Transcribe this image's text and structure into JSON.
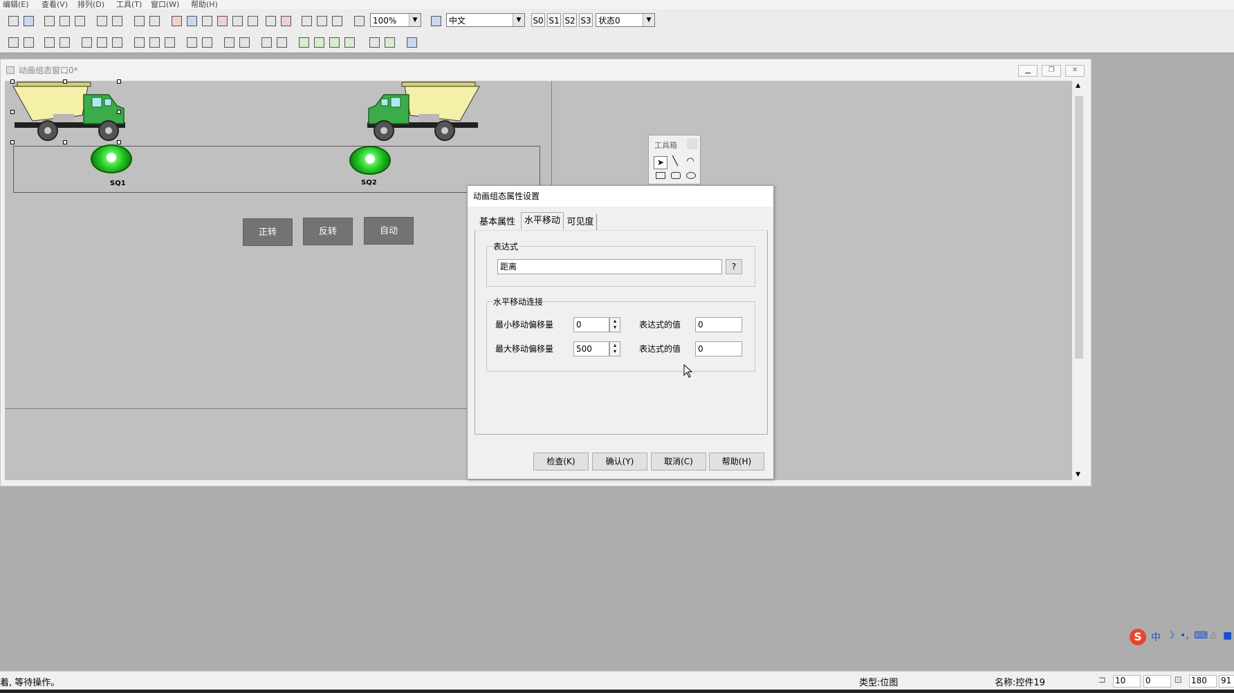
{
  "menu": [
    "编辑(E)",
    "查看(V)",
    "排列(D)",
    "工具(T)",
    "窗口(W)",
    "帮助(H)"
  ],
  "toolbar": {
    "zoom": "100%",
    "language": "中文",
    "states": [
      "S0",
      "S1",
      "S2",
      "S3"
    ],
    "state_select": "状态0"
  },
  "child_window": {
    "title": "动画组态窗口0*",
    "buttons": [
      "minimize-icon",
      "restore-icon",
      "close-icon"
    ]
  },
  "scene": {
    "sensors": [
      {
        "label": "SQ1",
        "color": "#22cc22"
      },
      {
        "label": "SQ2",
        "color": "#22cc22"
      }
    ],
    "trucks": [
      "truck-left",
      "truck-right"
    ],
    "buttons": [
      "正转",
      "反转",
      "自动"
    ]
  },
  "toolbox": {
    "title": "工具箱",
    "tools": [
      "pointer-icon",
      "line-icon",
      "arc-icon",
      "rectangle-icon",
      "rounded-rect-icon",
      "ellipse-icon"
    ]
  },
  "dialog": {
    "title": "动画组态属性设置",
    "tabs": [
      "基本属性",
      "水平移动",
      "可见度"
    ],
    "active_tab": "水平移动",
    "expression_group": "表达式",
    "expression_value": "距离",
    "expression_help": "?",
    "move_group": "水平移动连接",
    "min_offset_label": "最小移动偏移量",
    "min_offset_value": "0",
    "max_offset_label": "最大移动偏移量",
    "max_offset_value": "500",
    "expr_value_label": "表达式的值",
    "expr_value_min": "0",
    "expr_value_max": "0",
    "buttons": {
      "check": "检查(K)",
      "confirm": "确认(Y)",
      "cancel": "取消(C)",
      "help": "帮助(H)"
    }
  },
  "status": {
    "message": "着, 等待操作。",
    "type": "类型:位图",
    "name": "名称:控件19",
    "x": "10",
    "y": "0",
    "w": "180",
    "h": "91"
  },
  "ime": {
    "label": "中"
  }
}
